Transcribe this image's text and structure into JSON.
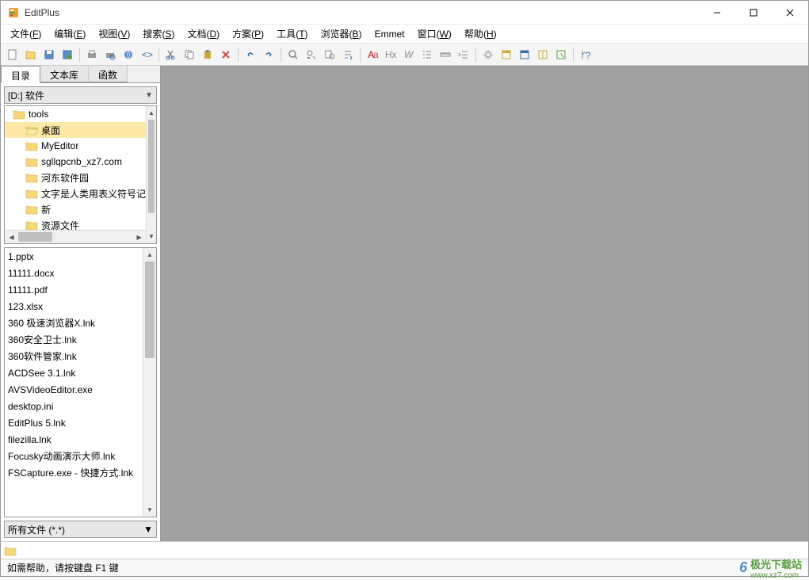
{
  "title": "EditPlus",
  "menu": [
    {
      "label": "文件",
      "key": "F"
    },
    {
      "label": "编辑",
      "key": "E"
    },
    {
      "label": "视图",
      "key": "V"
    },
    {
      "label": "搜索",
      "key": "S"
    },
    {
      "label": "文档",
      "key": "D"
    },
    {
      "label": "方案",
      "key": "P"
    },
    {
      "label": "工具",
      "key": "T"
    },
    {
      "label": "浏览器",
      "key": "B"
    },
    {
      "label": "Emmet",
      "key": ""
    },
    {
      "label": "窗口",
      "key": "W"
    },
    {
      "label": "帮助",
      "key": "H"
    }
  ],
  "tabs": [
    {
      "label": "目录",
      "active": true
    },
    {
      "label": "文本库",
      "active": false
    },
    {
      "label": "函数",
      "active": false
    }
  ],
  "drive": "[D:] 软件",
  "tree": [
    {
      "label": "tools",
      "depth": 0,
      "selected": false
    },
    {
      "label": "桌面",
      "depth": 1,
      "selected": true
    },
    {
      "label": "MyEditor",
      "depth": 1,
      "selected": false
    },
    {
      "label": "sgllqpcnb_xz7.com",
      "depth": 1,
      "selected": false
    },
    {
      "label": "河东软件园",
      "depth": 1,
      "selected": false
    },
    {
      "label": "文字是人类用表义符号记",
      "depth": 1,
      "selected": false
    },
    {
      "label": "新",
      "depth": 1,
      "selected": false
    },
    {
      "label": "资源文件",
      "depth": 1,
      "selected": false
    }
  ],
  "files": [
    "1.pptx",
    "11111.docx",
    "11111.pdf",
    "123.xlsx",
    "360 极速浏览器X.lnk",
    "360安全卫士.lnk",
    "360软件管家.lnk",
    "ACDSee 3.1.lnk",
    "AVSVideoEditor.exe",
    "desktop.ini",
    "EditPlus 5.lnk",
    "filezilla.lnk",
    "Focusky动画演示大师.lnk",
    "FSCapture.exe - 快捷方式.lnk"
  ],
  "filter": "所有文件 (*.*)",
  "status": "如需帮助，请按键盘 F1 键",
  "watermark": {
    "brand": "极光下载站",
    "url": "www.xz7.com"
  }
}
